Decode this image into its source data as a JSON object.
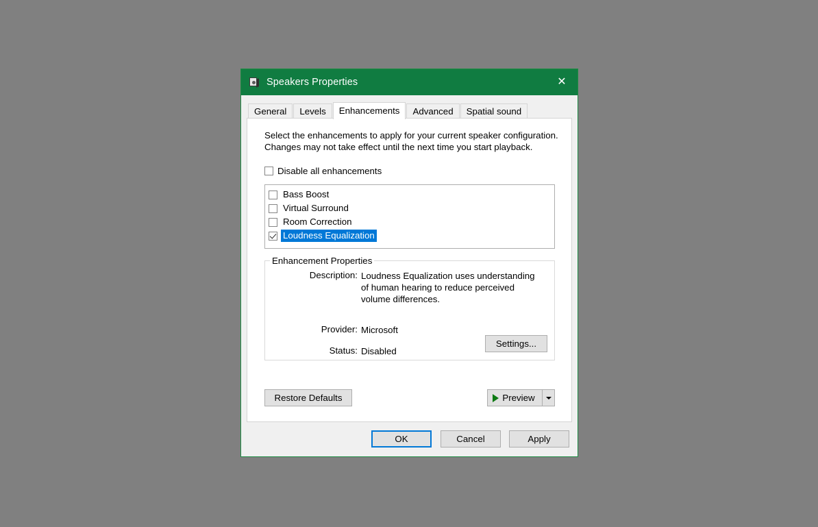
{
  "window": {
    "title": "Speakers Properties",
    "icon": "speaker-icon",
    "close_label": "✕",
    "titlebar_color": "#107c41"
  },
  "tabs": [
    {
      "label": "General",
      "active": false
    },
    {
      "label": "Levels",
      "active": false
    },
    {
      "label": "Enhancements",
      "active": true
    },
    {
      "label": "Advanced",
      "active": false
    },
    {
      "label": "Spatial sound",
      "active": false
    }
  ],
  "page": {
    "description": "Select the enhancements to apply for your current speaker configuration. Changes may not take effect until the next time you start playback.",
    "disable_all": {
      "label": "Disable all enhancements",
      "checked": false
    },
    "enhancements": [
      {
        "label": "Bass Boost",
        "checked": false,
        "selected": false
      },
      {
        "label": "Virtual Surround",
        "checked": false,
        "selected": false
      },
      {
        "label": "Room Correction",
        "checked": false,
        "selected": false
      },
      {
        "label": "Loudness Equalization",
        "checked": true,
        "selected": true
      }
    ],
    "properties": {
      "group_title": "Enhancement Properties",
      "description_label": "Description:",
      "description_value": "Loudness Equalization uses understanding of human hearing to reduce perceived volume differences.",
      "provider_label": "Provider:",
      "provider_value": "Microsoft",
      "status_label": "Status:",
      "status_value": "Disabled",
      "settings_button": "Settings..."
    },
    "restore_defaults_button": "Restore Defaults",
    "preview_button": "Preview"
  },
  "footer": {
    "ok": "OK",
    "cancel": "Cancel",
    "apply": "Apply"
  },
  "colors": {
    "title_green": "#107c41",
    "selection_blue": "#0078d7",
    "play_green": "#0d7a13"
  }
}
